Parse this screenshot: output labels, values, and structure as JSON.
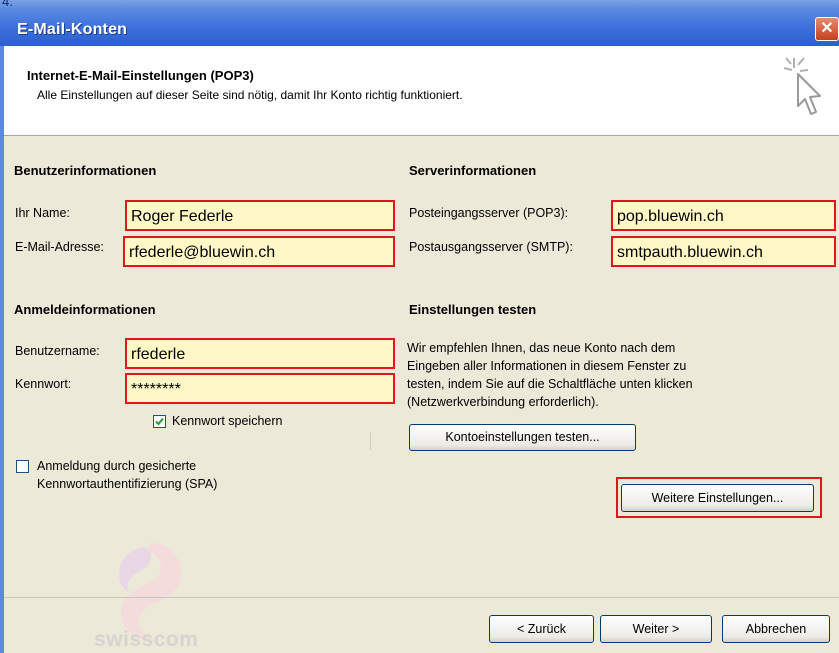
{
  "window": {
    "step": "4.",
    "title": "E-Mail-Konten",
    "close_label": "✕"
  },
  "header": {
    "title": "Internet-E-Mail-Einstellungen (POP3)",
    "subtitle": "Alle Einstellungen auf dieser Seite sind nötig, damit Ihr Konto richtig funktioniert.",
    "icon": "cursor-sparkle-icon"
  },
  "user_info": {
    "heading": "Benutzerinformationen",
    "name_label": "Ihr Name:",
    "name_value": "Roger Federle",
    "email_label": "E-Mail-Adresse:",
    "email_value": "rfederle@bluewin.ch"
  },
  "server_info": {
    "heading": "Serverinformationen",
    "incoming_label": "Posteingangsserver (POP3):",
    "incoming_value": "pop.bluewin.ch",
    "outgoing_label": "Postausgangsserver (SMTP):",
    "outgoing_value": "smtpauth.bluewin.ch"
  },
  "login_info": {
    "heading": "Anmeldeinformationen",
    "username_label": "Benutzername:",
    "username_value": "rfederle",
    "password_label": "Kennwort:",
    "password_value": "********",
    "save_password_label": "Kennwort speichern",
    "save_password_checked": true,
    "spa_label_line1": "Anmeldung durch gesicherte",
    "spa_label_line2": "Kennwortauthentifizierung (SPA)",
    "spa_checked": false
  },
  "test_settings": {
    "heading": "Einstellungen testen",
    "desc_line1": "Wir empfehlen Ihnen, das neue Konto nach dem",
    "desc_line2": "Eingeben aller Informationen in diesem Fenster zu",
    "desc_line3": "testen, indem Sie auf die Schaltfläche unten klicken",
    "desc_line4": "(Netzwerkverbindung erforderlich).",
    "test_button": "Kontoeinstellungen testen...",
    "more_button": "Weitere Einstellungen..."
  },
  "footer": {
    "back_button": "< Zurück",
    "next_button": "Weiter >",
    "cancel_button": "Abbrechen",
    "logo_text": "swisscom"
  },
  "colors": {
    "highlight_border": "#e0161d",
    "field_bg": "#fff8c6",
    "titlebar": "#3c70dc"
  }
}
